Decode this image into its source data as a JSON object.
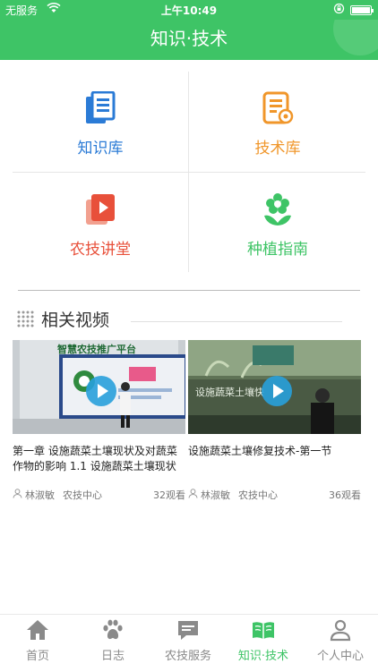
{
  "status_bar": {
    "carrier": "无服务",
    "time": "上午10:49",
    "battery_level_percent": 100
  },
  "header": {
    "title": "知识·技术"
  },
  "grid": [
    {
      "label": "知识库",
      "icon": "book-list-icon",
      "color": "#2b7bd6"
    },
    {
      "label": "技术库",
      "icon": "document-gear-icon",
      "color": "#f0962a"
    },
    {
      "label": "农技讲堂",
      "icon": "video-play-icon",
      "color": "#e8503a"
    },
    {
      "label": "种植指南",
      "icon": "flower-sprout-icon",
      "color": "#3ec466"
    }
  ],
  "section": {
    "title": "相关视频"
  },
  "videos": [
    {
      "title": "第一章 设施蔬菜土壤现状及对蔬菜作物的影响 1.1 设施蔬菜土壤现状",
      "author": "林淑敏",
      "org": "农技中心",
      "views": "32观看",
      "thumb_text": "智慧农技推广平台"
    },
    {
      "title": "设施蔬菜土壤修复技术-第一节",
      "author": "林淑敏",
      "org": "农技中心",
      "views": "36观看",
      "thumb_text": "设施蔬菜土壤快"
    }
  ],
  "tabs": [
    {
      "label": "首页",
      "icon": "home-icon"
    },
    {
      "label": "日志",
      "icon": "paw-icon"
    },
    {
      "label": "农技服务",
      "icon": "chat-icon"
    },
    {
      "label": "知识·技术",
      "icon": "open-book-icon",
      "active": true
    },
    {
      "label": "个人中心",
      "icon": "person-icon"
    }
  ],
  "colors": {
    "brand_green": "#3ec466",
    "inactive_gray": "#8a8a8a"
  }
}
